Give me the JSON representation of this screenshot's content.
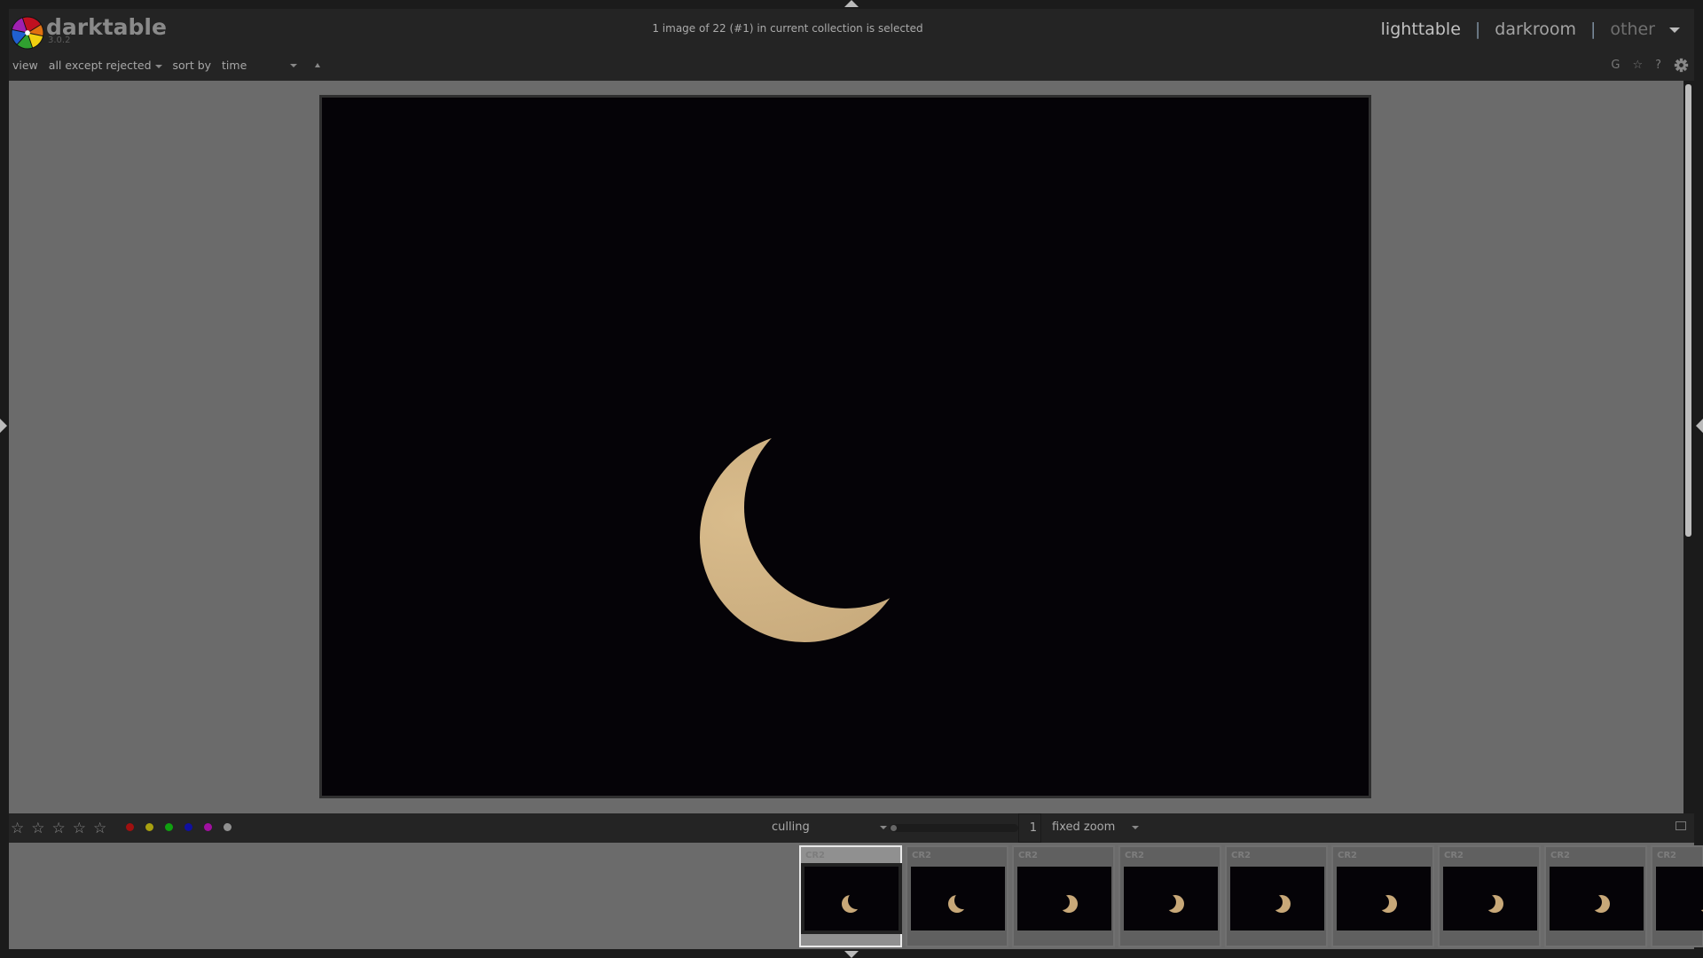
{
  "app": {
    "name": "darktable",
    "version": "3.0.2"
  },
  "status": "1 image of 22 (#1) in current collection is selected",
  "views": {
    "items": [
      {
        "label": "lighttable",
        "active": true
      },
      {
        "label": "darkroom",
        "active": false
      },
      {
        "label": "other",
        "active": false
      }
    ],
    "separator": "|"
  },
  "filterbar": {
    "view_label": "view",
    "view_value": "all except rejected",
    "sort_label": "sort by",
    "sort_value": "time"
  },
  "tools": {
    "grouping": "G",
    "overlay_icon": "star-icon",
    "help": "?",
    "prefs_icon": "gear-icon"
  },
  "bottombar": {
    "stars": [
      "☆",
      "☆",
      "☆",
      "☆",
      "☆"
    ],
    "color_labels": [
      "#a01010",
      "#a8a010",
      "#10a010",
      "#1010a0",
      "#a010a0",
      "#909090"
    ],
    "layout": "culling",
    "zoom_value": "1",
    "zoom_mode": "fixed zoom"
  },
  "filmstrip": {
    "thumbs": [
      {
        "format": "CR2",
        "selected": true,
        "phase": "crescent"
      },
      {
        "format": "CR2",
        "selected": false,
        "phase": "crescent"
      },
      {
        "format": "CR2",
        "selected": false,
        "phase": "half"
      },
      {
        "format": "CR2",
        "selected": false,
        "phase": "half"
      },
      {
        "format": "CR2",
        "selected": false,
        "phase": "half"
      },
      {
        "format": "CR2",
        "selected": false,
        "phase": "half"
      },
      {
        "format": "CR2",
        "selected": false,
        "phase": "half"
      },
      {
        "format": "CR2",
        "selected": false,
        "phase": "half"
      },
      {
        "format": "CR2",
        "selected": false,
        "phase": "half"
      }
    ]
  },
  "colors": {
    "panel": "#242424",
    "background": "#6b6b6b",
    "moon": "#c8a878"
  }
}
